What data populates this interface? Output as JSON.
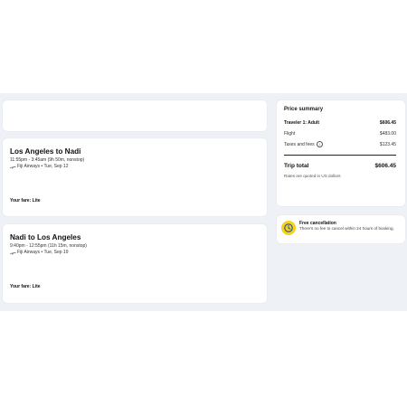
{
  "outbound": {
    "route": "Los Angeles to Nadi",
    "times": "11:55pm - 3:45am (9h 50m, nonstop)",
    "airline": "Fiji Airways • Tue, Sep 12",
    "fare": "Your fare: Lite"
  },
  "return": {
    "route": "Nadi to Los Angeles",
    "times": "9:40pm - 12:55pm (11h 15m, nonstop)",
    "airline": "Fiji Airways • Tue, Sep 19",
    "fare": "Your fare: Lite"
  },
  "price_summary": {
    "title": "Price summary",
    "traveler_label": "Traveler 1: Adult",
    "traveler_amount": "$606.45",
    "flight_label": "Flight",
    "flight_amount": "$483.00",
    "taxes_label": "Taxes and fees",
    "taxes_amount": "$123.45",
    "total_label": "Trip total",
    "total_amount": "$606.45",
    "currency_note": "Rates are quoted in US dollars"
  },
  "cancellation": {
    "title": "Free cancellation",
    "text": "There's no fee to cancel within 24 hours of booking."
  },
  "colors": {
    "background": "#eef1f6",
    "card": "#ffffff",
    "badge": "#f7d21a",
    "badge_icon": "#1e4fa8"
  },
  "icons": {
    "airline": "plane-icon",
    "info": "info-icon",
    "cancellation": "clock-check-icon"
  }
}
